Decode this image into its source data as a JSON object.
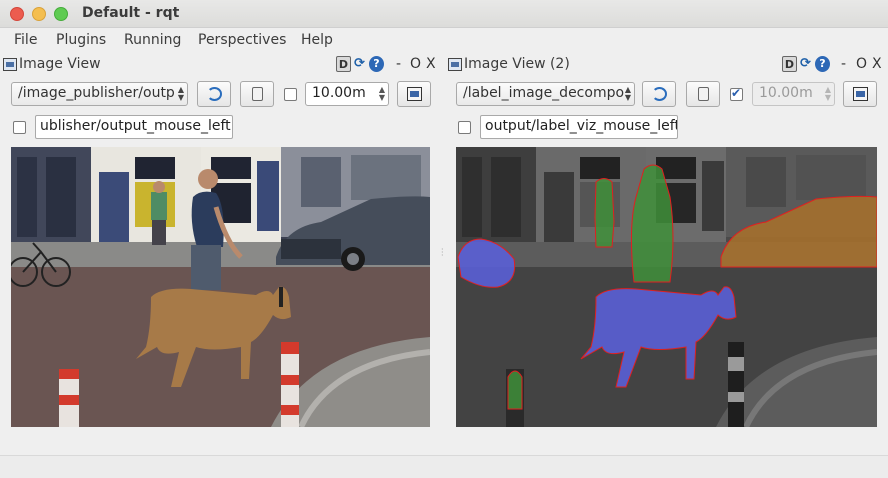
{
  "window": {
    "title": "Default - rqt"
  },
  "menubar": {
    "items": [
      {
        "label": "File"
      },
      {
        "label": "Plugins"
      },
      {
        "label": "Running"
      },
      {
        "label": "Perspectives"
      },
      {
        "label": "Help"
      }
    ]
  },
  "panels": [
    {
      "title": "Image View",
      "d_btn": "D",
      "controls": {
        "minimize": "-",
        "float": "O",
        "close": "X"
      },
      "topic_combo": "/image_publisher/outp",
      "smooth_checked": false,
      "rate_value": "10.00m",
      "rate_disabled": false,
      "mouse_checked": false,
      "mouse_topic": "ublisher/output_mouse_left",
      "image_type": "original"
    },
    {
      "title": "Image View (2)",
      "d_btn": "D",
      "controls": {
        "minimize": "-",
        "float": "O",
        "close": "X"
      },
      "topic_combo": "/label_image_decompo",
      "smooth_checked": true,
      "rate_value": "10.00m",
      "rate_disabled": true,
      "mouse_checked": false,
      "mouse_topic": "output/label_viz_mouse_left",
      "image_type": "label-visualization"
    }
  ],
  "colors": {
    "titlebar": "#dcdcda",
    "window_bg": "#efefef",
    "close": "#ec5c4f",
    "minimize": "#f4be4f",
    "maximize": "#5fcb52",
    "label_blue": "#5a5fd6",
    "label_green": "#3f8f3a",
    "label_orange": "#a9712a",
    "label_outline": "#e02020"
  }
}
